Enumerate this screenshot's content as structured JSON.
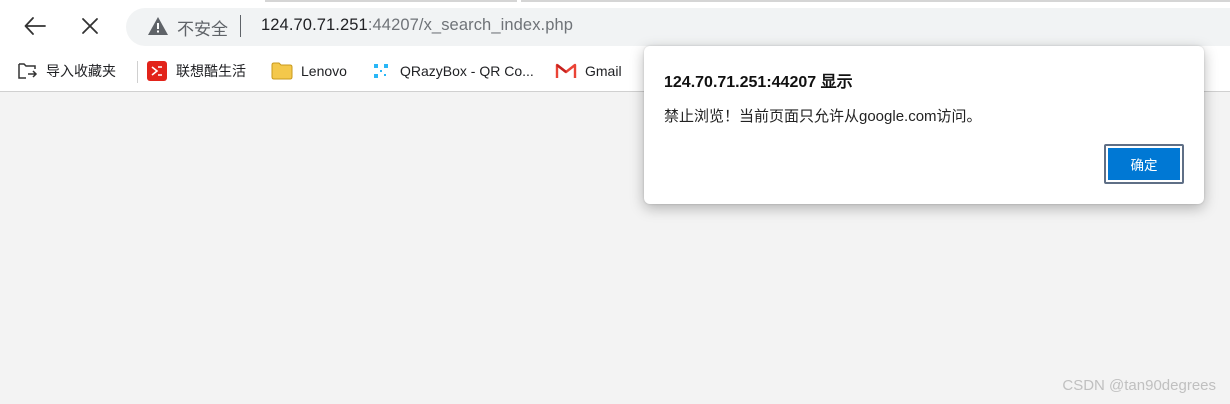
{
  "toolbar": {
    "security_label": "不安全",
    "url_host": "124.70.71.251",
    "url_rest": ":44207/x_search_index.php"
  },
  "bookmarks": [
    {
      "label": "导入收藏夹",
      "icon": "import-icon"
    },
    {
      "label": "联想酷生活",
      "icon": "lenovo-life-icon"
    },
    {
      "label": "Lenovo",
      "icon": "folder-icon"
    },
    {
      "label": "QRazyBox - QR Co...",
      "icon": "qr-icon"
    },
    {
      "label": "Gmail",
      "icon": "gmail-icon"
    }
  ],
  "dialog": {
    "title": "124.70.71.251:44207 显示",
    "message": "禁止浏览！当前页面只允许从google.com访问。",
    "ok_label": "确定"
  },
  "watermark": "CSDN @tan90degrees",
  "colors": {
    "accent": "#0078d4",
    "page_bg": "#f3f3f3",
    "warning": "#5f6368",
    "gmail_red": "#ea4335",
    "qr_blue": "#29b6f6",
    "folder_yellow": "#f4c84b",
    "lenovo_red": "#e2231a"
  }
}
